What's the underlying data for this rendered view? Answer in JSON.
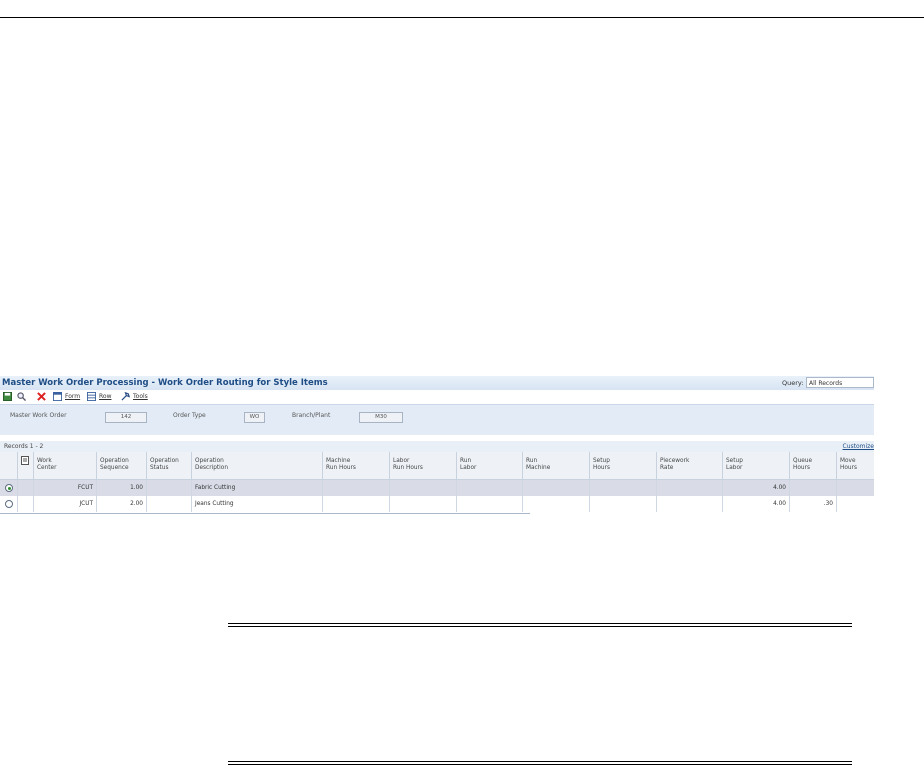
{
  "window": {
    "title": "Master Work Order Processing - Work Order Routing for Style Items",
    "query_label": "Query:",
    "query_value": "All Records"
  },
  "toolbar": {
    "save_icon": "save-icon",
    "find_icon": "find-icon",
    "delete_icon": "delete-icon",
    "form_label": "Form",
    "row_label": "Row",
    "tools_label": "Tools"
  },
  "header": {
    "master_work_order_label": "Master Work Order",
    "master_work_order_value": "142",
    "order_type_label": "Order Type",
    "order_type_value": "WO",
    "branch_plant_label": "Branch/Plant",
    "branch_plant_value": "M30"
  },
  "grid": {
    "records_label": "Records 1 - 2",
    "customize_label": "Customize",
    "columns": [
      "Work\nCenter",
      "Operation\nSequence",
      "Operation\nStatus",
      "Operation\nDescription",
      "Machine\nRun Hours",
      "Labor\nRun Hours",
      "Run\nLabor",
      "Run\nMachine",
      "Setup\nHours",
      "Piecework\nRate",
      "Setup\nLabor",
      "Queue\nHours",
      "Move\nHours"
    ],
    "rows": [
      {
        "work_center": "FCUT",
        "op_seq": "1.00",
        "op_status": "",
        "description": "Fabric Cutting",
        "setup_labor": "4.00",
        "queue_hours": "",
        "selected": true
      },
      {
        "work_center": "JCUT",
        "op_seq": "2.00",
        "op_status": "",
        "description": "Jeans Cutting",
        "setup_labor": "4.00",
        "queue_hours": ".30",
        "selected": false
      }
    ]
  }
}
